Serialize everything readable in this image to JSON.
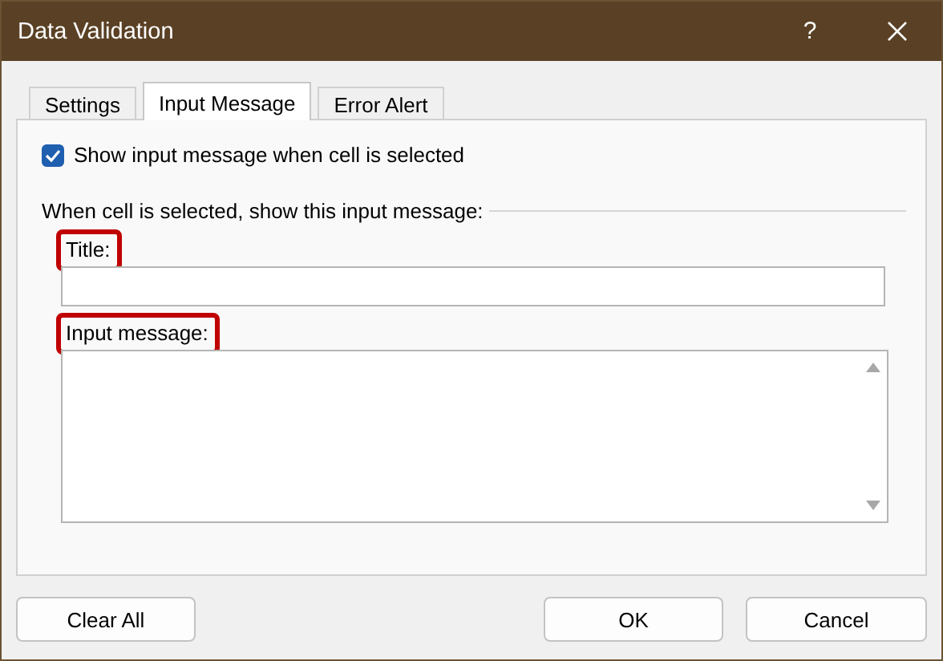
{
  "window": {
    "title": "Data Validation",
    "help_glyph": "?"
  },
  "tabs": [
    {
      "label": "Settings",
      "selected": false
    },
    {
      "label": "Input Message",
      "selected": true
    },
    {
      "label": "Error Alert",
      "selected": false
    }
  ],
  "show_checkbox": {
    "label": "Show input message when cell is selected",
    "checked": true
  },
  "section_label": "When cell is selected, show this input message:",
  "title_field": {
    "label": "Title:",
    "highlighted": true
  },
  "message_field": {
    "label": "Input message:",
    "highlighted": true
  },
  "buttons": [
    {
      "label": "Clear All"
    },
    {
      "label": "OK"
    },
    {
      "label": "Cancel"
    }
  ]
}
